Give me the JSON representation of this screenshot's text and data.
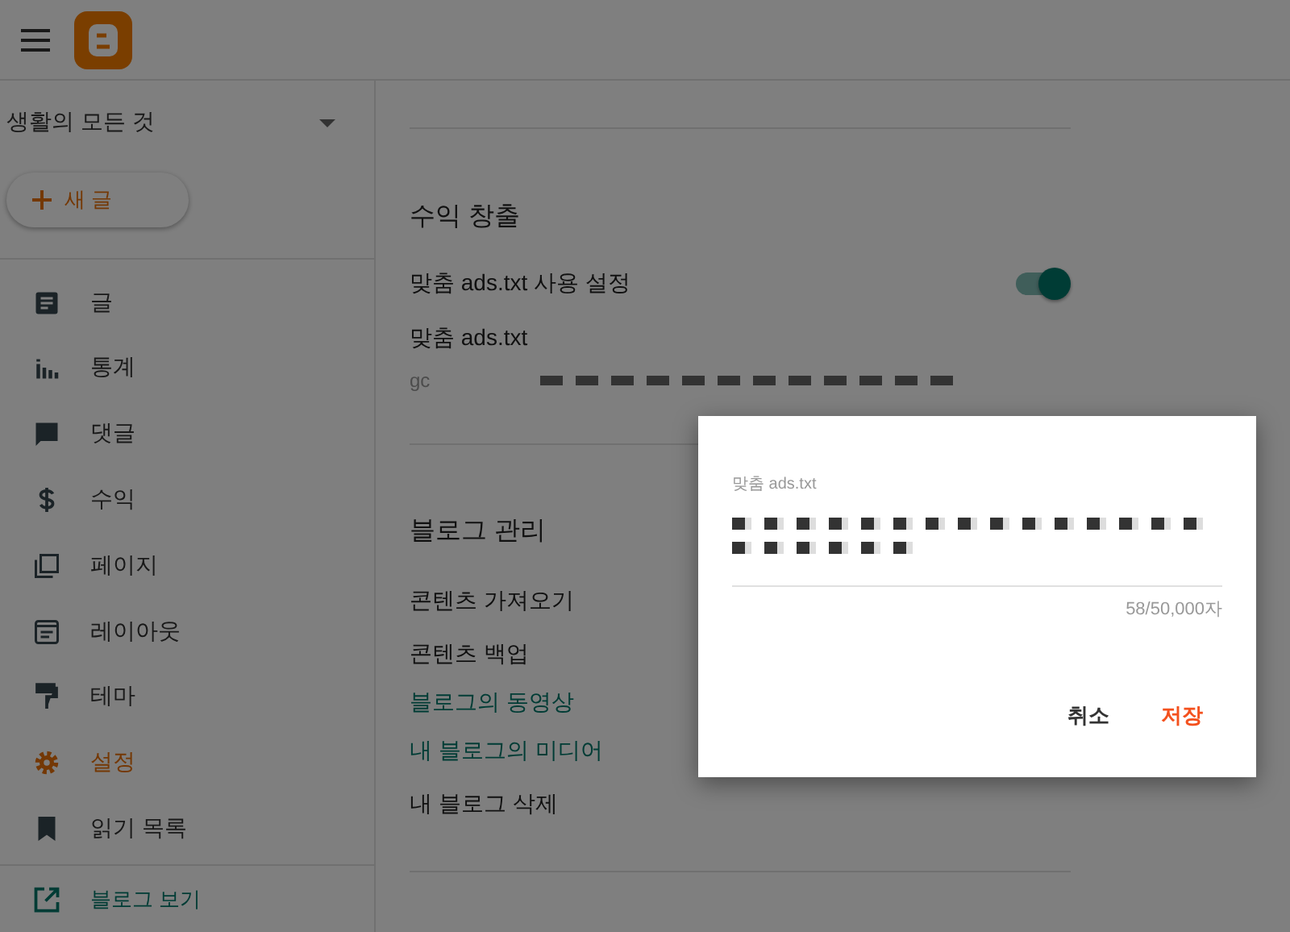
{
  "sidebar": {
    "blog_name": "생활의 모든 것",
    "new_post_button": "새 글",
    "items": [
      {
        "label": "글",
        "selected": false
      },
      {
        "label": "통계",
        "selected": false
      },
      {
        "label": "댓글",
        "selected": false
      },
      {
        "label": "수익",
        "selected": false
      },
      {
        "label": "페이지",
        "selected": false
      },
      {
        "label": "레이아웃",
        "selected": false
      },
      {
        "label": "테마",
        "selected": false
      },
      {
        "label": "설정",
        "selected": true
      },
      {
        "label": "읽기 목록",
        "selected": false
      }
    ],
    "view_blog_link": "블로그 보기"
  },
  "monetization": {
    "heading": "수익 창출",
    "custom_ads_toggle": {
      "label": "맞춤 ads.txt 사용 설정",
      "on": true
    },
    "custom_ads_label": "맞춤 ads.txt",
    "custom_ads_value_prefix": "gc"
  },
  "blog_management": {
    "heading": "블로그 관리",
    "items": [
      {
        "label": "콘텐츠 가져오기",
        "kind": "text"
      },
      {
        "label": "콘텐츠 백업",
        "kind": "text"
      },
      {
        "label": "블로그의 동영상",
        "kind": "link"
      },
      {
        "label": "내 블로그의 미디어",
        "kind": "link"
      },
      {
        "label": "내 블로그 삭제",
        "kind": "text"
      }
    ]
  },
  "dialog": {
    "field_label": "맞춤 ads.txt",
    "counter": "58/50,000자",
    "buttons": [
      {
        "label": "취소",
        "kind": "cancel"
      },
      {
        "label": "저장",
        "kind": "save"
      }
    ]
  }
}
